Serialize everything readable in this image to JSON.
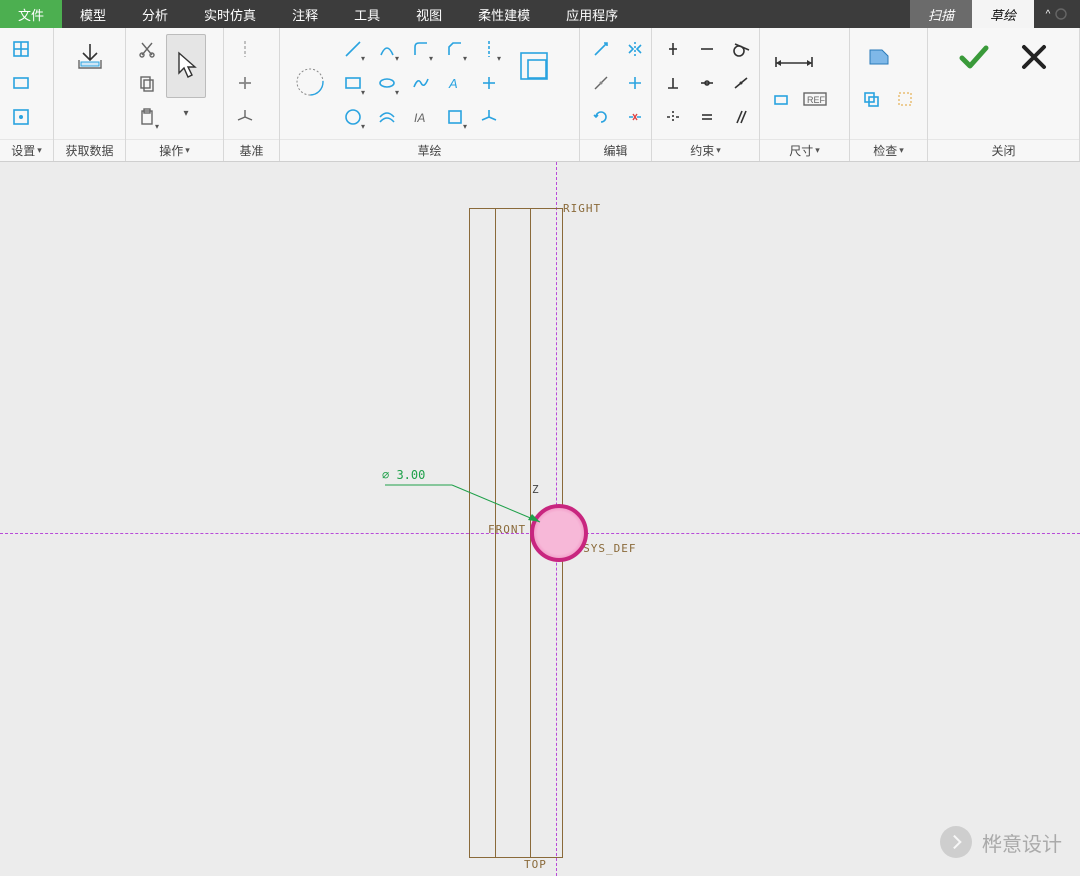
{
  "menubar": {
    "file": "文件",
    "tabs": [
      "模型",
      "分析",
      "实时仿真",
      "注释",
      "工具",
      "视图",
      "柔性建模",
      "应用程序"
    ],
    "context_tab": "扫描",
    "active_tab": "草绘"
  },
  "ribbon": {
    "groups": {
      "settings": "设置",
      "getdata": "获取数据",
      "operate": "操作",
      "datum": "基准",
      "sketch": "草绘",
      "edit": "编辑",
      "constrain": "约束",
      "dimension": "尺寸",
      "inspect": "检查",
      "close": "关闭"
    }
  },
  "canvas": {
    "datum_right": "RIGHT",
    "datum_top": "TOP",
    "datum_front": "FRONT",
    "axis_z": "Z",
    "csys": "PRT_CSYS_DEF",
    "dimension": "∅ 3.00"
  },
  "watermark": "桦意设计"
}
